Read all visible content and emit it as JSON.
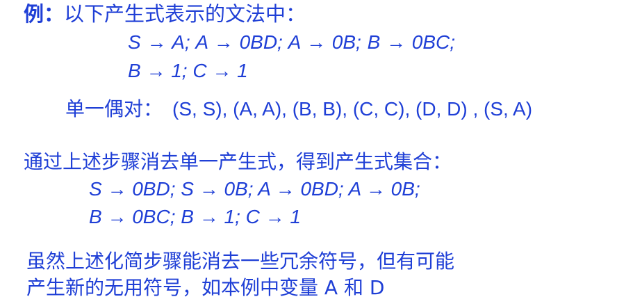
{
  "intro": {
    "example_label": "例",
    "colon": "：",
    "text": "以下产生式表示的文法中："
  },
  "grammar_lines": [
    "S → A;   A → 0BD;   A → 0B;   B → 0BC;",
    "B → 1;    C → 1"
  ],
  "unit_pairs": {
    "label": "单一偶对：",
    "pairs": "(S, S), (A, A), (B, B), (C, C), (D, D) , (S, A)"
  },
  "result_intro": "通过上述步骤消去单一产生式，得到产生式集合：",
  "result_lines": [
    "S → 0BD; S → 0B; A → 0BD; A → 0B;",
    "B → 0BC; B → 1;   C → 1"
  ],
  "note_lines": [
    "虽然上述化简步骤能消去一些冗余符号，但有可能",
    "产生新的无用符号，如本例中变量 A 和 D"
  ],
  "colors": {
    "text": "#1f3fd6"
  }
}
